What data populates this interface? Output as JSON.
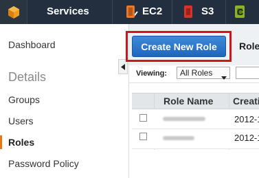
{
  "topbar": {
    "services_label": "Services",
    "shortcuts": [
      {
        "label": "EC2",
        "icon": "ec2-icon",
        "color": "#e8782c"
      },
      {
        "label": "S3",
        "icon": "s3-icon",
        "color": "#d6332b"
      },
      {
        "label": "C",
        "icon": "cloudformation-icon",
        "color": "#8ab22d"
      }
    ]
  },
  "sidebar": {
    "items": [
      {
        "label": "Dashboard"
      },
      {
        "label": "Details",
        "heading": true
      },
      {
        "label": "Groups"
      },
      {
        "label": "Users"
      },
      {
        "label": "Roles",
        "active": true
      },
      {
        "label": "Password Policy"
      }
    ]
  },
  "main": {
    "create_button": "Create New Role",
    "role_actions": "Role",
    "viewing_label": "Viewing:",
    "viewing_selected": "All Roles",
    "table": {
      "columns": [
        "Role Name",
        "Creati"
      ],
      "rows": [
        {
          "date": "2012-1"
        },
        {
          "date": "2012-1"
        }
      ]
    }
  },
  "colors": {
    "topbar_bg": "#232f3e",
    "primary_button": "#1e66be",
    "highlight_border": "#d0131d",
    "active_accent": "#e47911"
  }
}
